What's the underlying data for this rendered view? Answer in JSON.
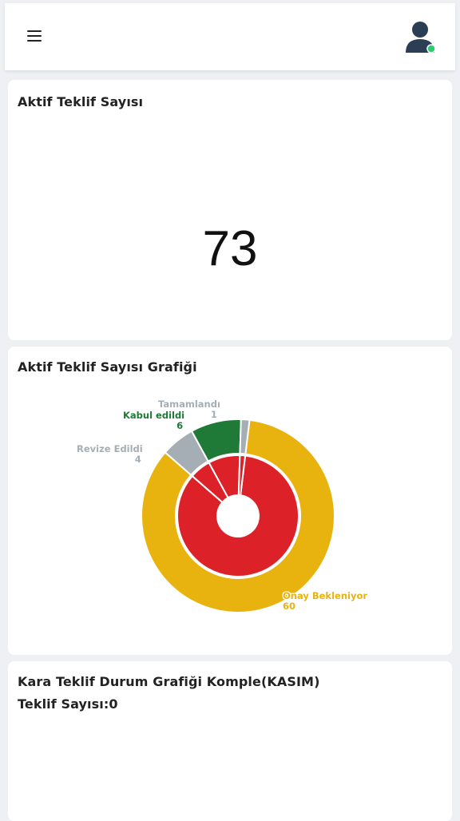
{
  "header": {
    "menu_icon": "hamburger-menu-icon",
    "avatar_icon": "user-avatar-icon",
    "status_color": "#2ecc71"
  },
  "active_offers": {
    "title": "Aktif Teklif Sayısı",
    "count": "73"
  },
  "offers_chart": {
    "title": "Aktif Teklif Sayısı Grafiği",
    "labels": [
      {
        "name": "Tamamlandı",
        "value": "1",
        "color": "#a5aeb5"
      },
      {
        "name": "Kabul edildi",
        "value": "6",
        "color": "#1e7a36"
      },
      {
        "name": "Revize Edildi",
        "value": "4",
        "color": "#a5aeb5"
      },
      {
        "name": "Onay Bekleniyor",
        "value": "60",
        "color": "#e8b30f"
      }
    ]
  },
  "chart_data": {
    "type": "pie",
    "categories": [
      "Onay Bekleniyor",
      "Revize Edildi",
      "Kabul edildi",
      "Tamamlandı"
    ],
    "values": [
      60,
      4,
      6,
      1
    ],
    "colors": [
      "#e8b30f",
      "#a5aeb5",
      "#1e7a36",
      "#a5aeb5"
    ],
    "inner_ring_color": "#dc2228"
  },
  "kara_chart": {
    "title": "Kara Teklif Durum Grafiği Komple(KASIM)",
    "count_line": "Teklif Sayısı:0"
  }
}
